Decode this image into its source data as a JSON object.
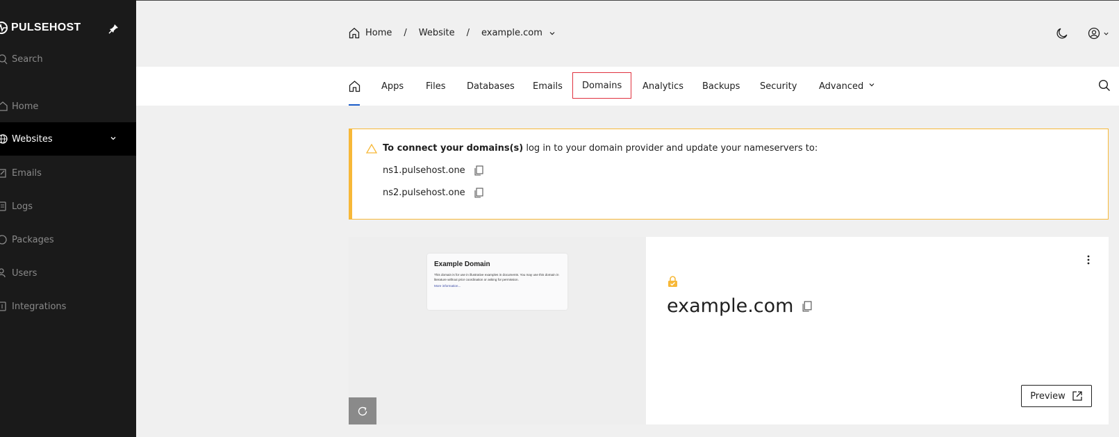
{
  "sidebar": {
    "logo": "PULSEHOST",
    "search_label": "Search",
    "items": [
      {
        "label": "Home",
        "icon": "home-icon"
      },
      {
        "label": "Websites",
        "icon": "globe-icon",
        "active": true
      },
      {
        "label": "Emails",
        "icon": "email-icon"
      },
      {
        "label": "Logs",
        "icon": "logs-icon"
      },
      {
        "label": "Packages",
        "icon": "package-icon"
      },
      {
        "label": "Users",
        "icon": "users-icon"
      },
      {
        "label": "Integrations",
        "icon": "integrations-icon"
      }
    ]
  },
  "breadcrumb": {
    "home": "Home",
    "sep1": "/",
    "website": "Website",
    "sep2": "/",
    "domain": "example.com"
  },
  "nav": {
    "tabs": [
      "Apps",
      "Files",
      "Databases",
      "Emails",
      "Domains",
      "Analytics",
      "Backups",
      "Security",
      "Advanced"
    ],
    "highlighted": "Domains"
  },
  "alert": {
    "bold": "To connect your domains(s)",
    "rest": " log in to your domain provider and update your nameservers to:",
    "ns1": "ns1.pulsehost.one",
    "ns2": "ns2.pulsehost.one"
  },
  "site": {
    "preview_title": "Example Domain",
    "preview_text": "This domain is for use in illustrative examples in documents. You may use this domain in literature without prior coordination or asking for permission.",
    "preview_link": "More information...",
    "domain": "example.com",
    "preview_button": "Preview"
  },
  "colors": {
    "sidebar_bg": "#1a1a1a",
    "accent_blue": "#1a5cc8",
    "alert_border": "#f7b838",
    "highlight_red": "#e0313e",
    "lock_orange": "#f7b838"
  }
}
